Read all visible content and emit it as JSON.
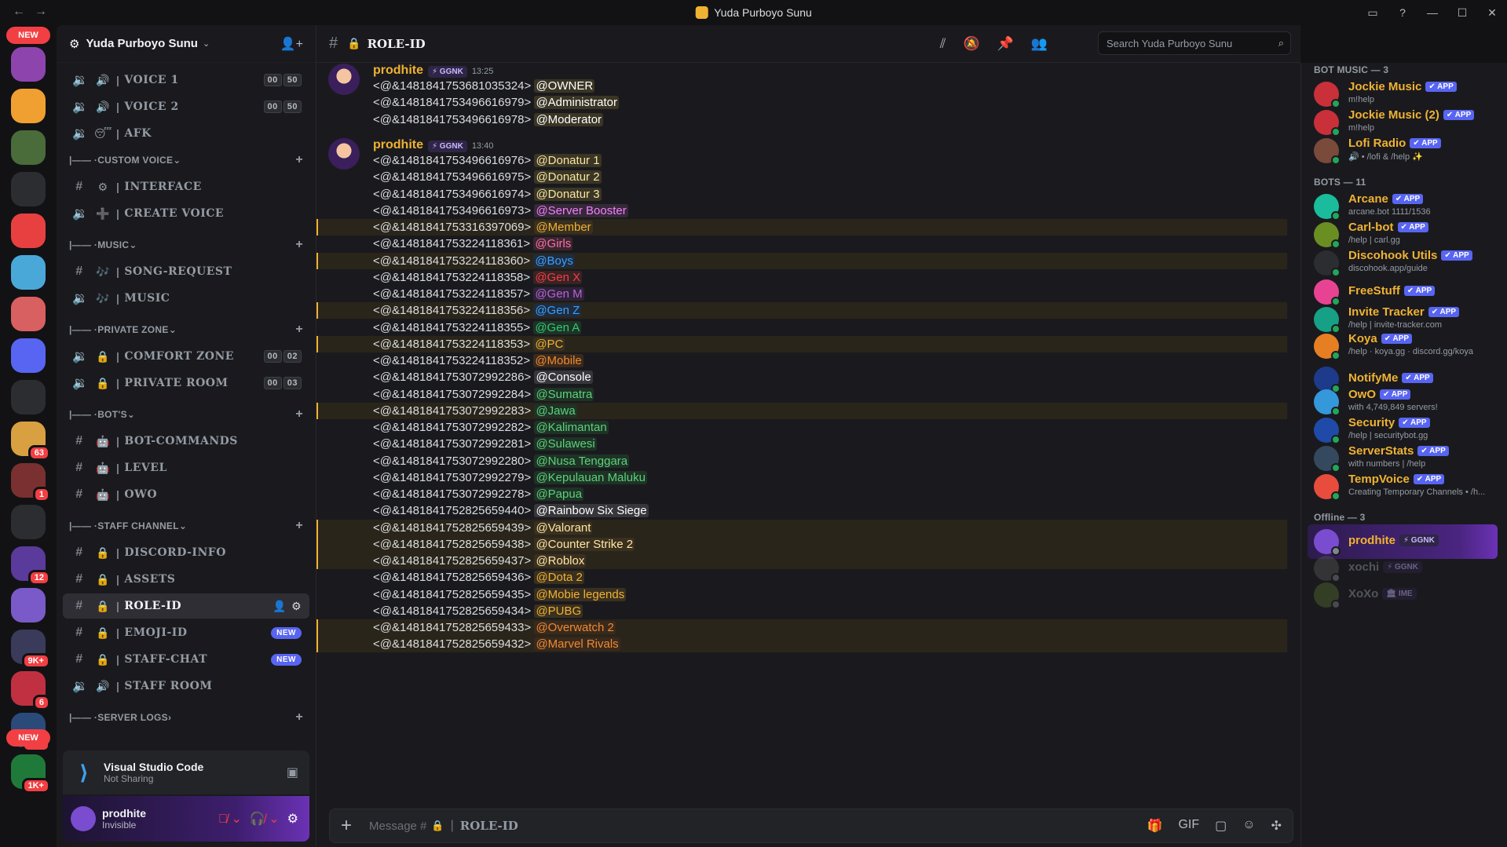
{
  "window": {
    "title": "Yuda Purboyo Sunu"
  },
  "guild_rail": {
    "new_label": "NEW",
    "badges": [
      "63",
      "1",
      "12",
      "9K+",
      "6",
      "1K+",
      "1K+"
    ]
  },
  "server": {
    "name": "Yuda Purboyo Sunu"
  },
  "channels": [
    {
      "type": "voice",
      "emoji": "🔊",
      "name": "VOICE 1",
      "count": [
        "00",
        "50"
      ]
    },
    {
      "type": "voice",
      "emoji": "🔊",
      "name": "VOICE 2",
      "count": [
        "00",
        "50"
      ]
    },
    {
      "type": "voice",
      "emoji": "😴",
      "name": "AFK"
    },
    {
      "type": "category",
      "name": "CUSTOM VOICE"
    },
    {
      "type": "text",
      "emoji": "⚙",
      "name": "INTERFACE"
    },
    {
      "type": "voice",
      "emoji": "➕",
      "name": "CREATE VOICE"
    },
    {
      "type": "category",
      "name": "MUSIC"
    },
    {
      "type": "text",
      "emoji": "🎶",
      "name": "SONG-REQUEST"
    },
    {
      "type": "voice",
      "emoji": "🎶",
      "name": "MUSIC"
    },
    {
      "type": "category",
      "name": "PRIVATE ZONE"
    },
    {
      "type": "voice",
      "emoji": "🔒",
      "name": "COMFORT ZONE",
      "count": [
        "00",
        "02"
      ]
    },
    {
      "type": "voice",
      "emoji": "🔒",
      "name": "PRIVATE ROOM",
      "count": [
        "00",
        "03"
      ]
    },
    {
      "type": "category",
      "name": "BOT'S"
    },
    {
      "type": "text",
      "emoji": "🤖",
      "name": "BOT-COMMANDS"
    },
    {
      "type": "text",
      "emoji": "🤖",
      "name": "LEVEL"
    },
    {
      "type": "text",
      "emoji": "🤖",
      "name": "OWO"
    },
    {
      "type": "category",
      "name": "STAFF CHANNEL"
    },
    {
      "type": "text",
      "emoji": "🔒",
      "name": "DISCORD-INFO"
    },
    {
      "type": "text",
      "emoji": "🔒",
      "name": "ASSETS"
    },
    {
      "type": "text",
      "emoji": "🔒",
      "name": "ROLE-ID",
      "active": true
    },
    {
      "type": "text",
      "emoji": "🔒",
      "name": "EMOJI-ID",
      "new": "NEW"
    },
    {
      "type": "text",
      "emoji": "🔒",
      "name": "STAFF-CHAT",
      "new": "NEW"
    },
    {
      "type": "voice",
      "emoji": "🔊",
      "name": "STAFF ROOM"
    },
    {
      "type": "category",
      "name": "SERVER LOGS",
      "collapsed": true
    }
  ],
  "activity": {
    "app": "Visual Studio Code",
    "status": "Not Sharing"
  },
  "user": {
    "name": "prodhite",
    "status": "Invisible"
  },
  "chat": {
    "channel": "ROLE-ID",
    "search_placeholder": "Search Yuda Purboyo Sunu",
    "composer_placeholder": "Message #",
    "composer_channel": "ROLE-ID",
    "messages": [
      {
        "author": "prodhite",
        "tag": "⚡ GGNK",
        "time": "13:25",
        "lines": [
          {
            "raw": "<@&1481841753681035324>",
            "role": "@OWNER",
            "color": "#ffffff",
            "bg": "#3a3524"
          },
          {
            "raw": "<@&1481841753496616979>",
            "role": "@Administrator",
            "color": "#ffffff",
            "bg": "#3a3524"
          },
          {
            "raw": "<@&1481841753496616978>",
            "role": "@Moderator",
            "color": "#ffffff",
            "bg": "#3a3524"
          }
        ]
      },
      {
        "author": "prodhite",
        "tag": "⚡ GGNK",
        "time": "13:40",
        "lines": [
          {
            "raw": "<@&1481841753496616976>",
            "role": "@Donatur 1",
            "color": "#f5e6a3",
            "bg": "#3a3524"
          },
          {
            "raw": "<@&1481841753496616975>",
            "role": "@Donatur 2",
            "color": "#f5e6a3",
            "bg": "#3a3524"
          },
          {
            "raw": "<@&1481841753496616974>",
            "role": "@Donatur 3",
            "color": "#f5e6a3",
            "bg": "#3a3524"
          },
          {
            "raw": "<@&1481841753496616973>",
            "role": "@Server Booster",
            "color": "#f47fff",
            "bg": "#352838"
          },
          {
            "raw": "<@&1481841753316397069>",
            "role": "@Member",
            "color": "#f0b232",
            "bg": "#3a3020",
            "hl": true
          },
          {
            "raw": "<@&1481841753224118361>",
            "role": "@Girls",
            "color": "#ff6fa6",
            "bg": "#3a2530"
          },
          {
            "raw": "<@&1481841753224118360>",
            "role": "@Boys",
            "color": "#3aa0ff",
            "bg": "#1f2c3d",
            "hl": true
          },
          {
            "raw": "<@&1481841753224118358>",
            "role": "@Gen X",
            "color": "#f23f43",
            "bg": "#3a2224"
          },
          {
            "raw": "<@&1481841753224118357>",
            "role": "@Gen M",
            "color": "#b665d6",
            "bg": "#2f2238"
          },
          {
            "raw": "<@&1481841753224118356>",
            "role": "@Gen Z",
            "color": "#3aa0ff",
            "bg": "#1f2c3d",
            "hl": true
          },
          {
            "raw": "<@&1481841753224118355>",
            "role": "@Gen A",
            "color": "#2ecc71",
            "bg": "#1e3326"
          },
          {
            "raw": "<@&1481841753224118353>",
            "role": "@PC",
            "color": "#f0b232",
            "bg": "#3a3020",
            "hl": true
          },
          {
            "raw": "<@&1481841753224118352>",
            "role": "@Mobile",
            "color": "#f08a32",
            "bg": "#3a2a1c"
          },
          {
            "raw": "<@&1481841753072992286>",
            "role": "@Console",
            "color": "#ffffff",
            "bg": "#36363b"
          },
          {
            "raw": "<@&1481841753072992284>",
            "role": "@Sumatra",
            "color": "#5dd17a",
            "bg": "#1e3326"
          },
          {
            "raw": "<@&1481841753072992283>",
            "role": "@Jawa",
            "color": "#5dd17a",
            "bg": "#1e3326",
            "hl": true
          },
          {
            "raw": "<@&1481841753072992282>",
            "role": "@Kalimantan",
            "color": "#5dd17a",
            "bg": "#1e3326"
          },
          {
            "raw": "<@&1481841753072992281>",
            "role": "@Sulawesi",
            "color": "#5dd17a",
            "bg": "#1e3326"
          },
          {
            "raw": "<@&1481841753072992280>",
            "role": "@Nusa Tenggara",
            "color": "#5dd17a",
            "bg": "#1e3326"
          },
          {
            "raw": "<@&1481841753072992279>",
            "role": "@Kepulauan Maluku",
            "color": "#5dd17a",
            "bg": "#1e3326"
          },
          {
            "raw": "<@&1481841753072992278>",
            "role": "@Papua",
            "color": "#5dd17a",
            "bg": "#1e3326"
          },
          {
            "raw": "<@&1481841752825659440>",
            "role": "@Rainbow Six Siege",
            "color": "#ffffff",
            "bg": "#36363b"
          },
          {
            "raw": "<@&1481841752825659439>",
            "role": "@Valorant",
            "color": "#ffe7a3",
            "bg": "#3a3020",
            "hl": true
          },
          {
            "raw": "<@&1481841752825659438>",
            "role": "@Counter Strike 2",
            "color": "#ffe7a3",
            "bg": "#3a3020",
            "hl": true
          },
          {
            "raw": "<@&1481841752825659437>",
            "role": "@Roblox",
            "color": "#ffe7a3",
            "bg": "#3a3020",
            "hl": true
          },
          {
            "raw": "<@&1481841752825659436>",
            "role": "@Dota 2",
            "color": "#f0b232",
            "bg": "#3a3020"
          },
          {
            "raw": "<@&1481841752825659435>",
            "role": "@Mobie legends",
            "color": "#f0b232",
            "bg": "#3a3020"
          },
          {
            "raw": "<@&1481841752825659434>",
            "role": "@PUBG",
            "color": "#f0b232",
            "bg": "#3a3020"
          },
          {
            "raw": "<@&1481841752825659433>",
            "role": "@Overwatch 2",
            "color": "#f08a32",
            "bg": "#3a2a1c",
            "hl": true
          },
          {
            "raw": "<@&1481841752825659432>",
            "role": "@Marvel Rivals",
            "color": "#f08a32",
            "bg": "#3a2a1c",
            "hl": true
          }
        ]
      }
    ]
  },
  "members": {
    "groups": [
      {
        "title": "BOT MUSIC — 3",
        "items": [
          {
            "name": "Jockie Music",
            "badge": "✔ APP",
            "sub": "m!help",
            "color": "#f0b232",
            "av": "#c9303a"
          },
          {
            "name": "Jockie Music (2)",
            "badge": "✔ APP",
            "sub": "m!help",
            "color": "#f0b232",
            "av": "#c9303a"
          },
          {
            "name": "Lofi Radio",
            "badge": "✔ APP",
            "sub": "🔊 • /lofi & /help ✨",
            "color": "#f0b232",
            "av": "#7a4a3a"
          }
        ]
      },
      {
        "title": "BOTS — 11",
        "items": [
          {
            "name": "Arcane",
            "badge": "✔ APP",
            "sub": "arcane.bot 1111/1536",
            "color": "#f0b232",
            "av": "#1abc9c"
          },
          {
            "name": "Carl-bot",
            "badge": "✔ APP",
            "sub": "/help | carl.gg",
            "color": "#f0b232",
            "av": "#6b8e23"
          },
          {
            "name": "Discohook Utils",
            "badge": "✔ APP",
            "sub": "discohook.app/guide",
            "color": "#f0b232",
            "av": "#2b2d31"
          },
          {
            "name": "FreeStuff",
            "badge": "✔ APP",
            "sub": "",
            "color": "#f0b232",
            "av": "#e84393"
          },
          {
            "name": "Invite Tracker",
            "badge": "✔ APP",
            "sub": "/help | invite-tracker.com",
            "color": "#f0b232",
            "av": "#16a085"
          },
          {
            "name": "Koya",
            "badge": "✔ APP",
            "sub": "/help · koya.gg · discord.gg/koya",
            "color": "#f0b232",
            "av": "#e67e22"
          },
          {
            "name": "NotifyMe",
            "badge": "✔ APP",
            "sub": "",
            "color": "#f0b232",
            "av": "#1e3a8a"
          },
          {
            "name": "OwO",
            "badge": "✔ APP",
            "sub": "with 4,749,849 servers!",
            "color": "#f0b232",
            "av": "#3498db"
          },
          {
            "name": "Security",
            "badge": "✔ APP",
            "sub": "/help | securitybot.gg",
            "color": "#f0b232",
            "av": "#1f4aa8"
          },
          {
            "name": "ServerStats",
            "badge": "✔ APP",
            "sub": "with numbers | /help",
            "color": "#f0b232",
            "av": "#34495e"
          },
          {
            "name": "TempVoice",
            "badge": "✔ APP",
            "sub": "Creating Temporary Channels • /h...",
            "color": "#f0b232",
            "av": "#e74c3c"
          }
        ]
      },
      {
        "title": "Offline — 3",
        "items": [
          {
            "name": "prodhite",
            "badge": "⚡ GGNK",
            "sub": "",
            "color": "#f0b232",
            "av": "#7a4ccf",
            "sel": true
          },
          {
            "name": "xochi",
            "badge": "⚡ GGNK",
            "sub": "",
            "color": "#f0b232",
            "av": "#555",
            "off": true
          },
          {
            "name": "XoXo",
            "badge": "🏛 IME",
            "sub": "",
            "color": "#f0b232",
            "av": "#556b2f",
            "off": true
          }
        ]
      }
    ]
  }
}
